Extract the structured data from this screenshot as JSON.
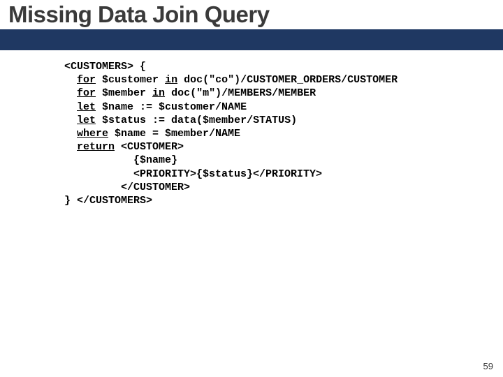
{
  "slide": {
    "title": "Missing Data Join Query",
    "page_number": "59"
  },
  "code": {
    "l1a": "<CUSTOMERS> {",
    "l2kw1": "for",
    "l2a": " $customer ",
    "l2kw2": "in",
    "l2b": " doc(\"co\")/CUSTOMER_ORDERS/CUSTOMER",
    "l3kw1": "for",
    "l3a": " $member ",
    "l3kw2": "in",
    "l3b": " doc(\"m\")/MEMBERS/MEMBER",
    "l4kw1": "let",
    "l4a": " $name := $customer/NAME",
    "l5kw1": "let",
    "l5a": " $status := data($member/STATUS)",
    "l6kw1": "where",
    "l6a": " $name = $member/NAME",
    "l7kw1": "return",
    "l7a": " <CUSTOMER>",
    "l8a": "           {$name}",
    "l9a": "           <PRIORITY>{$status}</PRIORITY>",
    "l10a": "         </CUSTOMER>",
    "l11a": "} </CUSTOMERS>"
  }
}
